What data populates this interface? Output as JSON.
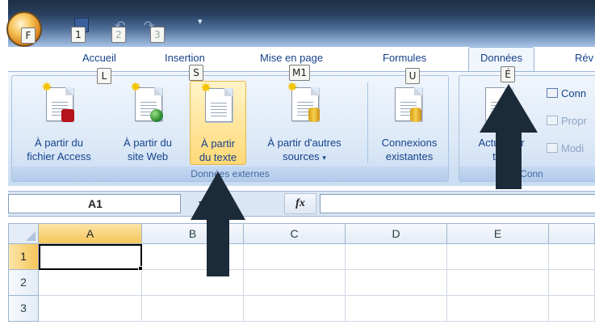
{
  "quick_access": {
    "keytips": {
      "office": "F",
      "save": "1",
      "undo": "2",
      "redo": "3"
    }
  },
  "tabs": [
    {
      "label": "Accueil",
      "keytip": "L"
    },
    {
      "label": "Insertion",
      "keytip": "S"
    },
    {
      "label": "Mise en page",
      "keytip": "M1"
    },
    {
      "label": "Formules",
      "keytip": "U"
    },
    {
      "label": "Données",
      "keytip": "É",
      "active": true
    },
    {
      "label": "Rév"
    }
  ],
  "ribbon": {
    "external_data": {
      "group_label": "Données externes",
      "commands": [
        {
          "line1": "À partir du",
          "line2": "fichier Access",
          "icon": "access-file-icon"
        },
        {
          "line1": "À partir du",
          "line2": "site Web",
          "icon": "web-page-icon"
        },
        {
          "line1": "À partir",
          "line2": "du texte",
          "icon": "text-file-icon",
          "highlighted": true
        },
        {
          "line1": "À partir d'autres",
          "line2": "sources",
          "dropdown": "▾",
          "icon": "other-sources-icon"
        },
        {
          "line1": "Connexions",
          "line2": "existantes",
          "icon": "existing-connections-icon"
        }
      ]
    },
    "connections": {
      "group_label": "Conn",
      "refresh": {
        "line1": "Actualiser",
        "line2": "tout"
      },
      "items": [
        {
          "label": "Conn",
          "enabled": true
        },
        {
          "label": "Propr",
          "enabled": false
        },
        {
          "label": "Modi",
          "enabled": false
        }
      ]
    }
  },
  "formula_bar": {
    "name_box": "A1",
    "fx_label": "fx",
    "formula": ""
  },
  "grid": {
    "columns": [
      "A",
      "B",
      "C",
      "D",
      "E"
    ],
    "rows": [
      "1",
      "2",
      "3"
    ],
    "active_cell": "A1"
  },
  "colors": {
    "arrow": "#1c2b3a",
    "ribbon_text": "#15428b",
    "highlight": "#ffd977"
  }
}
